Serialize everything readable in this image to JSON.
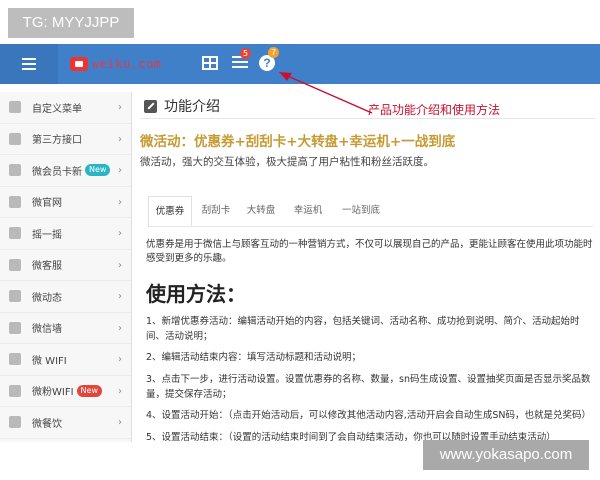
{
  "watermarks": {
    "top_left": "TG: MYYJJPP",
    "bottom_right": "www.yokasapo.com"
  },
  "topbar": {
    "brand_text": "weiku.com",
    "badge_list": "5",
    "badge_help": "7",
    "help_symbol": "?",
    "icons": [
      "menu-icon",
      "logo-icon",
      "grid-icon",
      "list-icon",
      "help-icon"
    ],
    "color": "#3f80c9"
  },
  "sidebar": {
    "items": [
      {
        "label": "自定义菜单",
        "icon": "menu-icon"
      },
      {
        "label": "第三方接口",
        "icon": "eye-icon"
      },
      {
        "label": "微会员卡新",
        "icon": "user-icon",
        "badge": "New",
        "badge_color": "#2ab5c6"
      },
      {
        "label": "微官网",
        "icon": "globe-icon"
      },
      {
        "label": "摇一摇",
        "icon": "shake-icon"
      },
      {
        "label": "微客服",
        "icon": "edit-icon"
      },
      {
        "label": "微动态",
        "icon": "gear-icon"
      },
      {
        "label": "微信墙",
        "icon": "wall-icon"
      },
      {
        "label": "微 WIFI",
        "icon": "signal-icon"
      },
      {
        "label": "微粉WIFI",
        "icon": "signal-icon",
        "badge": "New",
        "badge_color": "#e0463b"
      },
      {
        "label": "微餐饮",
        "icon": "fork-icon"
      }
    ]
  },
  "main": {
    "page_title": "功能介绍",
    "annotation": "产品功能介绍和使用方法",
    "headline": "微活动：优惠券+刮刮卡+大转盘+幸运机+一战到底",
    "subtitle": "微活动，强大的交互体验，极大提高了用户粘性和粉丝活跃度。",
    "tabs": [
      {
        "label": "优惠券",
        "active": true
      },
      {
        "label": "刮刮卡",
        "active": false
      },
      {
        "label": "大转盘",
        "active": false
      },
      {
        "label": "幸运机",
        "active": false
      },
      {
        "label": "一站到底",
        "active": false
      }
    ],
    "description": "优惠券是用于微信上与顾客互动的一种营销方式，不仅可以展现自己的产品，更能让顾客在使用此项功能时感受到更多的乐趣。",
    "usage_title": "使用方法：",
    "steps": [
      "1、新增优惠券活动：编辑活动开始的内容，包括关键词、活动名称、成功抢到说明、简介、活动起始时间、活动说明；",
      "2、编辑活动结束内容：填写活动标题和活动说明；",
      "3、点击下一步，进行活动设置。设置优惠券的名称、数量，sn码生成设置、设置抽奖页面是否显示奖品数量，提交保存活动；",
      "4、设置活动开始：（点击开始活动后，可以修改其他活动内容,活动开启会自动生成SN码，也就是兑奖码）",
      "5、设置活动结束：（设置的活动结束时间到了会自动结束活动，你也可以随时设置手动结束活动）"
    ]
  }
}
